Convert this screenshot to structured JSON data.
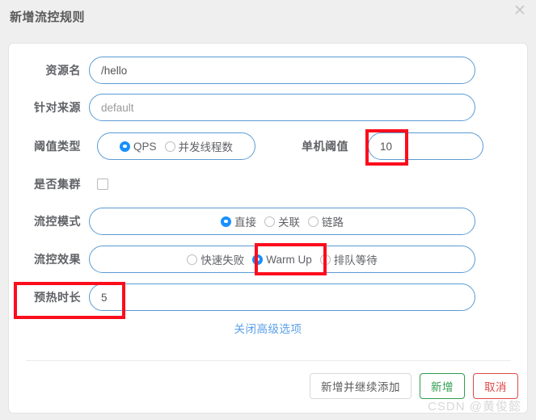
{
  "dialog": {
    "title": "新增流控规则",
    "close_icon": "close-icon",
    "close_glyph": "✕"
  },
  "form": {
    "resource": {
      "label": "资源名",
      "value": "/hello",
      "placeholder": "资源名"
    },
    "limit_app": {
      "label": "针对来源",
      "value": "",
      "placeholder": "default"
    },
    "threshold_type": {
      "label": "阈值类型",
      "options": [
        {
          "label": "QPS",
          "checked": true
        },
        {
          "label": "并发线程数",
          "checked": false
        }
      ]
    },
    "single_threshold": {
      "label": "单机阈值",
      "value": "10",
      "placeholder": ""
    },
    "is_cluster": {
      "label": "是否集群",
      "checked": false
    },
    "flow_mode": {
      "label": "流控模式",
      "options": [
        {
          "label": "直接",
          "checked": true
        },
        {
          "label": "关联",
          "checked": false
        },
        {
          "label": "链路",
          "checked": false
        }
      ]
    },
    "flow_effect": {
      "label": "流控效果",
      "options": [
        {
          "label": "快速失败",
          "checked": false
        },
        {
          "label": "Warm Up",
          "checked": true
        },
        {
          "label": "排队等待",
          "checked": false
        }
      ]
    },
    "warm_up_period": {
      "label": "预热时长",
      "value": "5",
      "placeholder": ""
    },
    "advanced_toggle": "关闭高级选项"
  },
  "footer": {
    "add_and_continue": "新增并继续添加",
    "add": "新增",
    "cancel": "取消"
  },
  "watermark": "CSDN @黄俊懿",
  "colors": {
    "annotation": "#fc0d1c",
    "accent_blue": "#1890ff",
    "border_blue": "#5b9bd5",
    "link_blue": "#5a9fe8",
    "success_green": "#2e9e4f",
    "danger_red": "#e04a4a",
    "page_bg": "#efefef"
  }
}
